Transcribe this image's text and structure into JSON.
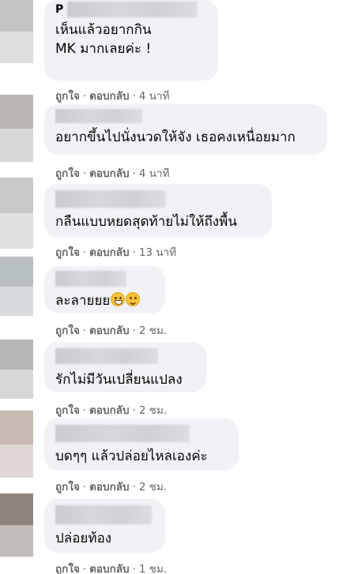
{
  "comments": [
    {
      "name_partial": "P",
      "text": "เห็นแล้วอยากกิน\nMK มากเลยค่ะ !",
      "like_label": "ถูกใจ",
      "reply_label": "ตอบกลับ",
      "time": "4 นาที",
      "avatar_color": "#c4c4c4",
      "emojis": []
    },
    {
      "name_partial": "",
      "text": "อยากขึ้นไปนั่งนวดให้จัง เธอคงเหนื่อยมาก",
      "like_label": "ถูกใจ",
      "reply_label": "ตอบกลับ",
      "time": "4 นาที",
      "avatar_color": "#b9b6b3",
      "emojis": []
    },
    {
      "name_partial": "",
      "text": "กลืนแบบหยดสุดท้ายไม่ให้ถึงพื้น",
      "like_label": "ถูกใจ",
      "reply_label": "ตอบกลับ",
      "time": "13 นาที",
      "avatar_color": "#c9c9c9",
      "emojis": []
    },
    {
      "name_partial": "",
      "text": "ละลายยย",
      "like_label": "ถูกใจ",
      "reply_label": "ตอบกลับ",
      "time": "2 ชม.",
      "avatar_color": "#b8bfc3",
      "emojis": [
        "grinning-face-icon",
        "smiling-face-icon"
      ]
    },
    {
      "name_partial": "",
      "text": "รักไม่มีวันเปลี่ยนแปลง",
      "like_label": "ถูกใจ",
      "reply_label": "ตอบกลับ",
      "time": "2 ชม.",
      "avatar_color": "#b7b6b4",
      "emojis": []
    },
    {
      "name_partial": "",
      "text": "บดๆๆ แล้วปล่อยไหลเองค่ะ",
      "like_label": "ถูกใจ",
      "reply_label": "ตอบกลับ",
      "time": "2 ชม.",
      "avatar_color": "#c9bab3",
      "emojis": []
    },
    {
      "name_partial": "",
      "text": "ปล่อยท้อง",
      "like_label": "ถูกใจ",
      "reply_label": "ตอบกลับ",
      "time": "1 ชม.",
      "avatar_color": "#8e857d",
      "emojis": []
    }
  ]
}
